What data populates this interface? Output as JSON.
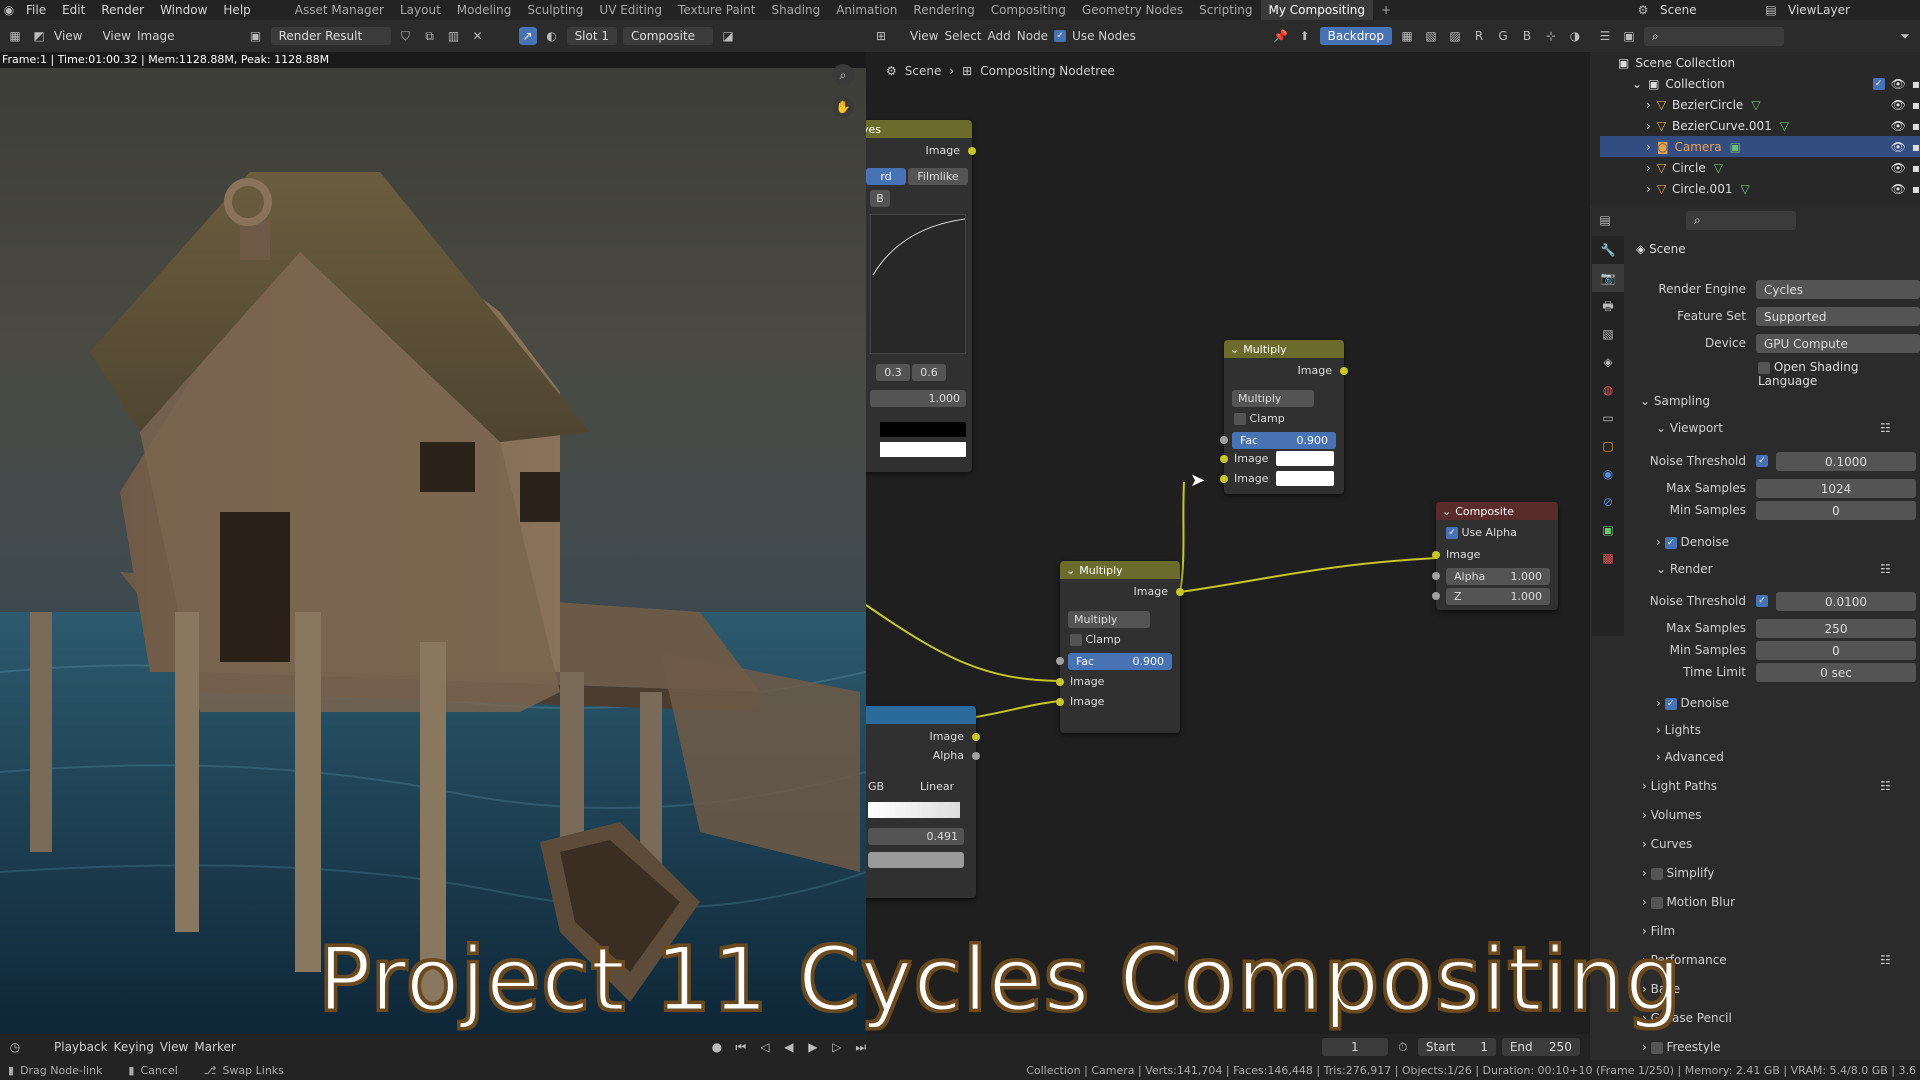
{
  "top_menu": {
    "items": [
      "File",
      "Edit",
      "Render",
      "Window",
      "Help"
    ],
    "workspaces": [
      "Asset Manager",
      "Layout",
      "Modeling",
      "Sculpting",
      "UV Editing",
      "Texture Paint",
      "Shading",
      "Animation",
      "Rendering",
      "Compositing",
      "Geometry Nodes",
      "Scripting",
      "My Compositing"
    ],
    "active_workspace": "My Compositing",
    "scene": "Scene",
    "view_layer": "ViewLayer"
  },
  "image_editor": {
    "view": "View",
    "image": "Image",
    "image_name": "Render Result",
    "slot": "Slot 1",
    "layer": "Composite",
    "render_info": "Frame:1 | Time:01:00.32 | Mem:1128.88M, Peak: 1128.88M"
  },
  "node_editor": {
    "menu": [
      "View",
      "Select",
      "Add",
      "Node"
    ],
    "use_nodes": "Use Nodes",
    "backdrop": "Backdrop",
    "channels": [
      "R",
      "G",
      "B"
    ],
    "breadcrumb": [
      "Scene",
      "Compositing Nodetree"
    ],
    "curves_node": {
      "title": "ves",
      "output": "Image",
      "tab_left": "rd",
      "tab_right": "Filmlike",
      "b_label": "B",
      "v1": "0.3",
      "v2": "0.6",
      "value": "1.000"
    },
    "multiply_top": {
      "title": "Multiply",
      "output": "Image",
      "blend": "Multiply",
      "clamp": "Clamp",
      "fac_label": "Fac",
      "fac": "0.900",
      "input1": "Image",
      "input2": "Image"
    },
    "multiply_mid": {
      "title": "Multiply",
      "output": "Image",
      "blend": "Multiply",
      "clamp": "Clamp",
      "fac_label": "Fac",
      "fac": "0.900",
      "input1": "Image",
      "input2": "Image"
    },
    "composite": {
      "title": "Composite",
      "use_alpha": "Use Alpha",
      "input": "Image",
      "alpha_label": "Alpha",
      "alpha": "1.000",
      "z_label": "Z",
      "z": "1.000"
    },
    "colorramp_node": {
      "out1": "Image",
      "out2": "Alpha",
      "mode": "GB",
      "interp": "Linear",
      "pos": "0.491"
    }
  },
  "outliner": {
    "title": "Scene Collection",
    "collection": "Collection",
    "items": [
      "BezierCircle",
      "BezierCurve.001",
      "Camera",
      "Circle",
      "Circle.001"
    ],
    "selected": "Camera"
  },
  "properties": {
    "scene": "Scene",
    "render_engine_label": "Render Engine",
    "render_engine": "Cycles",
    "feature_set_label": "Feature Set",
    "feature_set": "Supported",
    "device_label": "Device",
    "device": "GPU Compute",
    "osl": "Open Shading Language",
    "sampling": "Sampling",
    "viewport": "Viewport",
    "noise_threshold_label": "Noise Threshold",
    "viewport_noise": "0.1000",
    "max_samples_label": "Max Samples",
    "viewport_max": "1024",
    "min_samples_label": "Min Samples",
    "viewport_min": "0",
    "denoise": "Denoise",
    "render": "Render",
    "render_noise": "0.0100",
    "render_max": "250",
    "render_min": "0",
    "time_limit_label": "Time Limit",
    "time_limit": "0 sec",
    "lights": "Lights",
    "advanced": "Advanced",
    "sections": [
      "Light Paths",
      "Volumes",
      "Curves",
      "Simplify",
      "Motion Blur",
      "Film",
      "Performance",
      "Bake",
      "Grease Pencil",
      "Freestyle"
    ]
  },
  "timeline": {
    "menus": [
      "Playback",
      "Keying",
      "View",
      "Marker"
    ],
    "frame": "1",
    "start_label": "Start",
    "start": "1",
    "end_label": "End",
    "end": "250"
  },
  "statusbar": {
    "left1": "Drag Node-link",
    "left2": "Cancel",
    "left3": "Swap Links",
    "right": "Collection | Camera | Verts:141,704 | Faces:146,448 | Tris:276,917 | Objects:1/26 | Duration: 00:10+10 (Frame 1/250) | Memory: 2.41 GB | VRAM: 5.4/8.0 GB | 3.6"
  },
  "caption": "Project 11 Cycles Compositing"
}
